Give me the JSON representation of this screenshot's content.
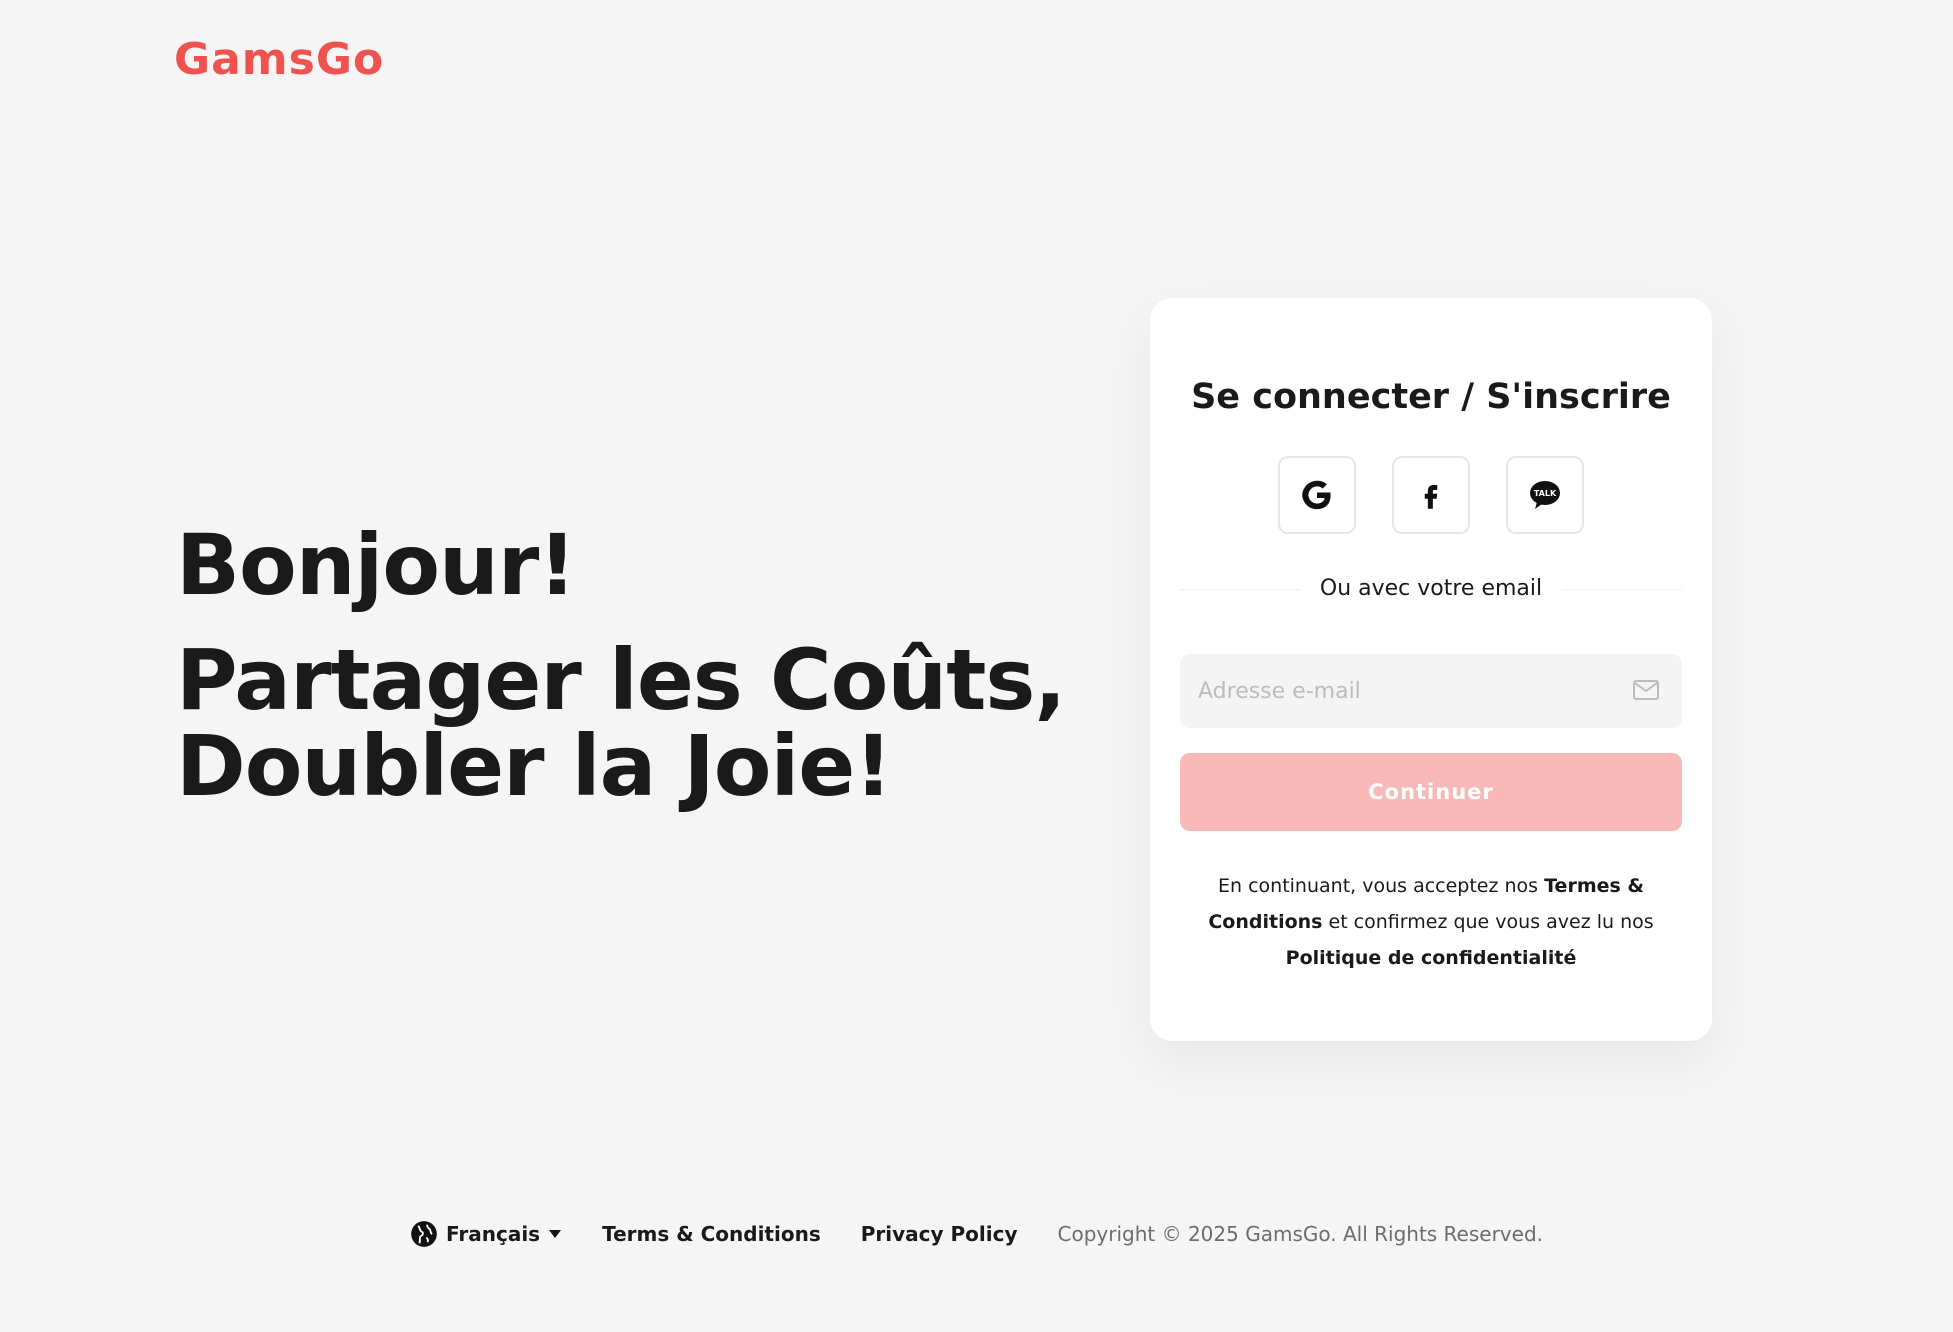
{
  "brand": {
    "logo_text": "GamsGo",
    "accent_color": "#ef5350"
  },
  "hero": {
    "greeting": "Bonjour!",
    "tagline_line1": "Partager les Coûts,",
    "tagline_line2": "Doubler la Joie!"
  },
  "auth": {
    "title": "Se connecter / S'inscrire",
    "social_buttons": [
      {
        "name": "google-icon",
        "label": "Google"
      },
      {
        "name": "facebook-icon",
        "label": "Facebook"
      },
      {
        "name": "kakaotalk-icon",
        "label": "TALK"
      }
    ],
    "divider_text": "Ou avec votre email",
    "email_placeholder": "Adresse e-mail",
    "email_value": "",
    "continue_label": "Continuer",
    "terms_prefix": "En continuant, vous acceptez nos ",
    "terms_link": "Termes & Conditions",
    "terms_middle": " et confirmez que vous avez lu nos ",
    "privacy_link": "Politique de confidentialité"
  },
  "footer": {
    "language": "Français",
    "terms": "Terms & Conditions",
    "privacy": "Privacy Policy",
    "copyright": "Copyright © 2025 GamsGo. All Rights Reserved."
  }
}
